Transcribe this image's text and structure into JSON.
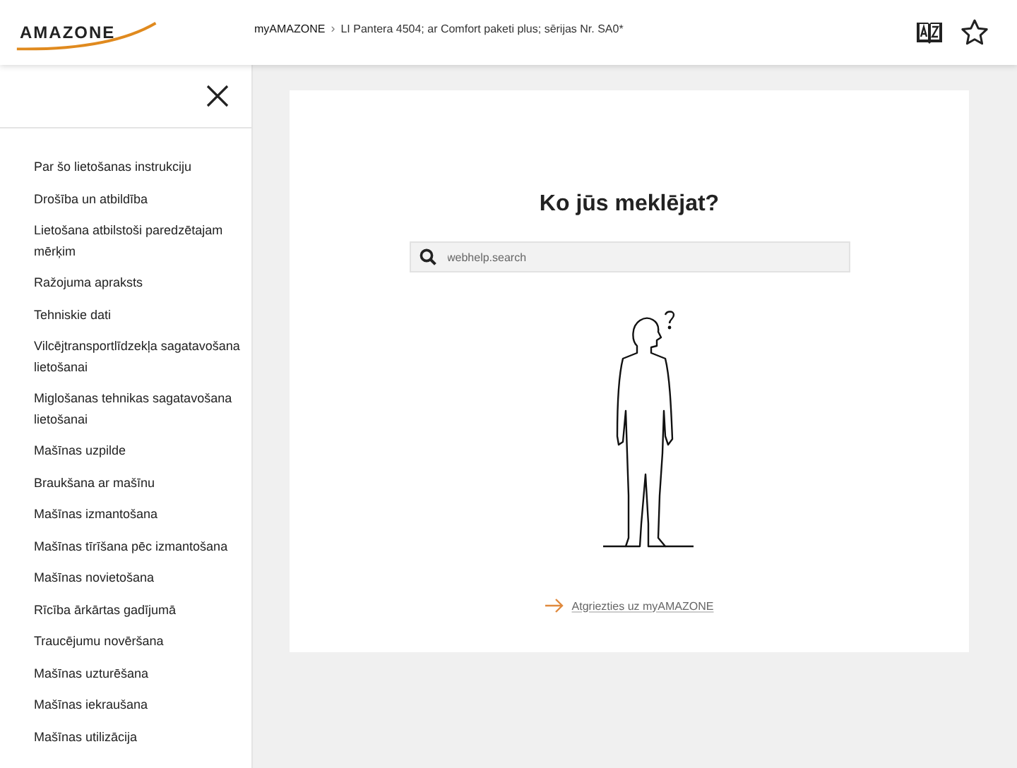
{
  "header": {
    "logo": "AMAZONE",
    "breadcrumb": [
      {
        "label": "myAMAZONE",
        "kind": "link"
      },
      {
        "label": "›",
        "kind": "separator"
      },
      {
        "label": "LI Pantera 4504; ar Comfort paketi plus; sērijas Nr. SA0*",
        "kind": "text"
      }
    ]
  },
  "sidebar": {
    "items": [
      {
        "label": "Par šo lietošanas instrukciju"
      },
      {
        "label": "Drošība un atbildība"
      },
      {
        "label": "Lietošana atbilstoši paredzētajam mērķim"
      },
      {
        "label": "Ražojuma apraksts"
      },
      {
        "label": "Tehniskie dati"
      },
      {
        "label": "Vilcējtransportlīdzekļa sagatavošana lietošanai"
      },
      {
        "label": "Miglošanas tehnikas sagatavošana lietošanai"
      },
      {
        "label": "Mašīnas uzpilde"
      },
      {
        "label": "Braukšana ar mašīnu"
      },
      {
        "label": "Mašīnas izmantošana"
      },
      {
        "label": "Mašīnas tīrīšana pēc izmantošana"
      },
      {
        "label": "Mašīnas novietošana"
      },
      {
        "label": "Rīcība ārkārtas gadījumā"
      },
      {
        "label": "Traucējumu novēršana"
      },
      {
        "label": "Mašīnas uzturēšana"
      },
      {
        "label": "Mašīnas iekraušana"
      },
      {
        "label": "Mašīnas utilizācija"
      }
    ]
  },
  "main": {
    "heading": "Ko jūs meklējat?",
    "search": {
      "placeholder": "webhelp.search"
    },
    "back_link": "Atgriezties uz myAMAZONE"
  }
}
